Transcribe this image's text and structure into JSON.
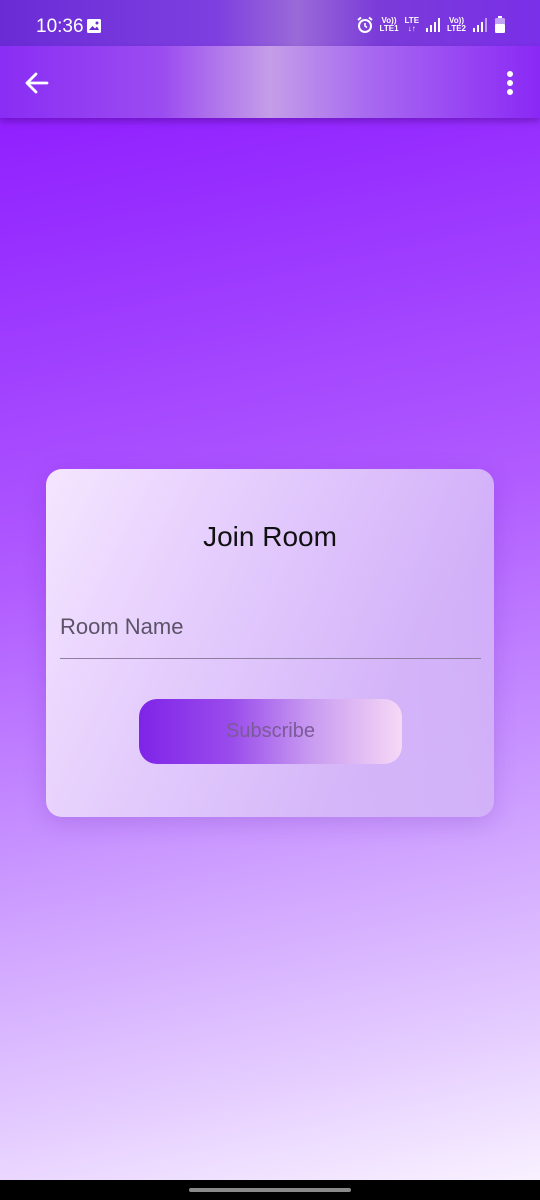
{
  "status_bar": {
    "time": "10:36",
    "sim1_top": "Vo))",
    "sim1_bottom": "LTE1",
    "lte_top": "LTE",
    "lte_bottom": "↓↑",
    "sim2_top": "Vo))",
    "sim2_bottom": "LTE2"
  },
  "app_bar": {
    "back_icon": "arrow-back-icon",
    "menu_icon": "more-vert-icon"
  },
  "card": {
    "title": "Join Room",
    "room_input": {
      "placeholder": "Room Name",
      "value": ""
    },
    "subscribe_label": "Subscribe"
  },
  "colors": {
    "primary": "#8a10ff",
    "card_bg": "#e6d2fc",
    "button_start": "#7f24e8",
    "button_end": "#f6d8f6"
  }
}
